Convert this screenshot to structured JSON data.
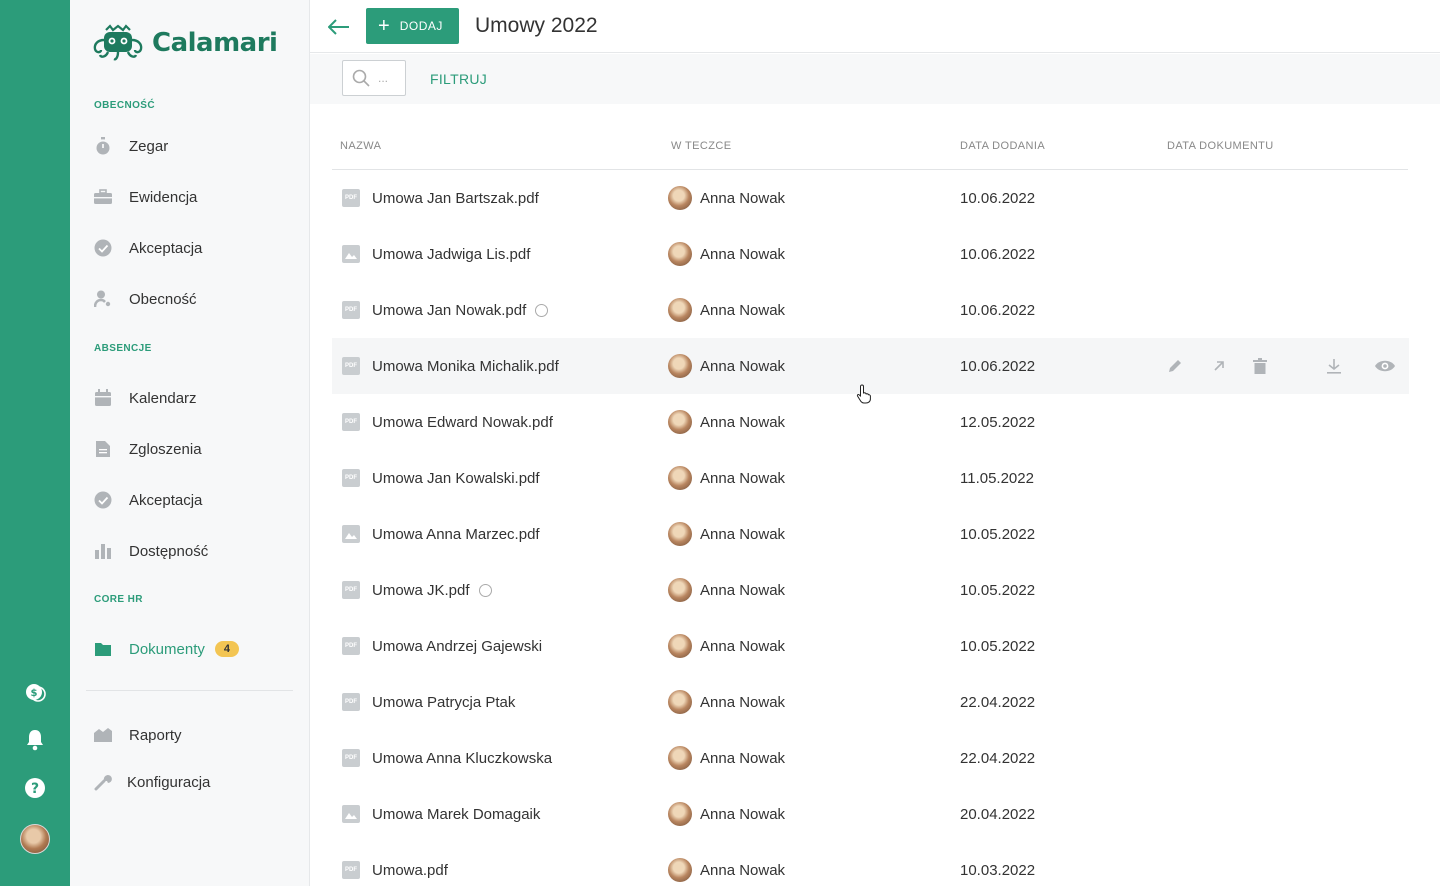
{
  "app": {
    "logo_text": "Calamari"
  },
  "colors": {
    "brand": "#2c9c7a",
    "badge": "#f3c553",
    "muted": "#b0b4b8"
  },
  "sidebar": {
    "sections": [
      {
        "title": "OBECNOŚĆ"
      },
      {
        "title": "ABSENCJE"
      },
      {
        "title": "CORE HR"
      }
    ],
    "items": [
      {
        "label": "Zegar",
        "icon": "stopwatch-icon"
      },
      {
        "label": "Ewidencja",
        "icon": "briefcase-icon"
      },
      {
        "label": "Akceptacja",
        "icon": "check-circle-icon"
      },
      {
        "label": "Obecność",
        "icon": "person-icon"
      },
      {
        "label": "Kalendarz",
        "icon": "calendar-icon"
      },
      {
        "label": "Zgloszenia",
        "icon": "document-icon"
      },
      {
        "label": "Akceptacja",
        "icon": "check-circle-icon"
      },
      {
        "label": "Dostępność",
        "icon": "bar-chart-icon"
      },
      {
        "label": "Dokumenty",
        "icon": "folder-icon",
        "badge": "4",
        "active": true
      },
      {
        "label": "Raporty",
        "icon": "report-icon"
      },
      {
        "label": "Konfiguracja",
        "icon": "wrench-icon"
      }
    ]
  },
  "rail": {
    "icons": [
      "coins-icon",
      "bell-icon",
      "help-icon",
      "user-avatar"
    ]
  },
  "header": {
    "add_label": "DODAJ",
    "title": "Umowy 2022"
  },
  "filterbar": {
    "search_placeholder": "...",
    "filter_label": "FILTRUJ"
  },
  "table": {
    "columns": [
      "NAZWA",
      "W TECZCE",
      "DATA DODANIA",
      "DATA DOKUMENTU"
    ],
    "rows": [
      {
        "name": "Umowa Jan Bartszak.pdf",
        "type": "pdf",
        "owner": "Anna Nowak",
        "date": "10.06.2022"
      },
      {
        "name": "Umowa Jadwiga Lis.pdf",
        "type": "image",
        "owner": "Anna Nowak",
        "date": "10.06.2022"
      },
      {
        "name": "Umowa Jan Nowak.pdf",
        "type": "pdf",
        "owner": "Anna Nowak",
        "date": "10.06.2022",
        "pending": true
      },
      {
        "name": "Umowa Monika Michalik.pdf",
        "type": "pdf",
        "owner": "Anna Nowak",
        "date": "10.06.2022",
        "hover": true
      },
      {
        "name": "Umowa Edward Nowak.pdf",
        "type": "pdf",
        "owner": "Anna Nowak",
        "date": "12.05.2022"
      },
      {
        "name": "Umowa Jan Kowalski.pdf",
        "type": "pdf",
        "owner": "Anna Nowak",
        "date": "11.05.2022"
      },
      {
        "name": "Umowa Anna Marzec.pdf",
        "type": "image",
        "owner": "Anna Nowak",
        "date": "10.05.2022"
      },
      {
        "name": "Umowa JK.pdf",
        "type": "pdf",
        "owner": "Anna Nowak",
        "date": "10.05.2022",
        "pending": true
      },
      {
        "name": "Umowa Andrzej Gajewski",
        "type": "pdf",
        "owner": "Anna Nowak",
        "date": "10.05.2022"
      },
      {
        "name": "Umowa Patrycja Ptak",
        "type": "pdf",
        "owner": "Anna Nowak",
        "date": "22.04.2022"
      },
      {
        "name": "Umowa Anna Kluczkowska",
        "type": "pdf",
        "owner": "Anna Nowak",
        "date": "22.04.2022"
      },
      {
        "name": "Umowa Marek Domagaik",
        "type": "image",
        "owner": "Anna Nowak",
        "date": "20.04.2022"
      },
      {
        "name": "Umowa.pdf",
        "type": "pdf",
        "owner": "Anna Nowak",
        "date": "10.03.2022"
      }
    ],
    "row_actions": [
      "edit-icon",
      "move-icon",
      "trash-icon",
      "download-icon",
      "eye-icon"
    ]
  }
}
